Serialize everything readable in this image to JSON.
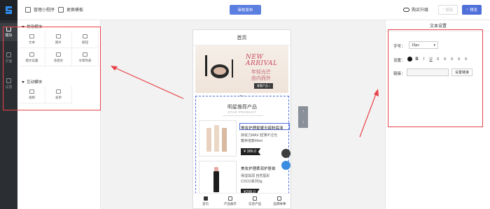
{
  "topbar": {
    "manage_label": "管理小程序",
    "template_label": "更换模板",
    "publish_label": "审核发布",
    "upgrade_label": "购买升级",
    "save_label": "保存",
    "preview_label": "预览"
  },
  "rail": {
    "items": [
      {
        "label": "模块",
        "icon": "module-icon"
      },
      {
        "label": "页面",
        "icon": "page-icon"
      },
      {
        "label": "设置",
        "icon": "settings-icon"
      }
    ]
  },
  "modules": {
    "common_title": "常用模块",
    "common_items": [
      "文本",
      "图片",
      "按钮",
      "图文设置",
      "多图文",
      "文章列表"
    ],
    "interactive_title": "互动模块",
    "interactive_items": [
      "视频",
      "表单"
    ]
  },
  "phone": {
    "title": "首页",
    "banner": {
      "new": "NEW",
      "arrival": "ARRIVAL",
      "cn_line1": "年轻光芒",
      "cn_line2": "由内而外",
      "button": "查看产品 >"
    },
    "recommend_title": "明星推荐产品",
    "recommend_sub": "STAR PRODUCT",
    "products": [
      {
        "name": "美妆护理星耀无痕粉底液",
        "desc1": "持妆力MAX 轻薄不泛光",
        "desc2": "蓄养倍数40ml",
        "price": "¥ 386.0"
      },
      {
        "name": "美妆护理柔润护唇膏",
        "desc1": "保湿滋润 自然唇彩",
        "desc2": "COCO系列3g",
        "price": "¥298.0"
      }
    ],
    "tabs": [
      "首页",
      "产品展示",
      "信息产品",
      "品牌故事"
    ]
  },
  "side_tools": {
    "up": "↑",
    "down": "↓"
  },
  "right_panel": {
    "title": "文本设置",
    "font_size_label": "字号：",
    "font_size_value": "15px",
    "style_label": "设置：",
    "link_label": "链接：",
    "link_button": "设置链接"
  },
  "colors": {
    "accent": "#4f6fd9",
    "annotation": "#e8434a",
    "rail": "#2b2f33"
  }
}
